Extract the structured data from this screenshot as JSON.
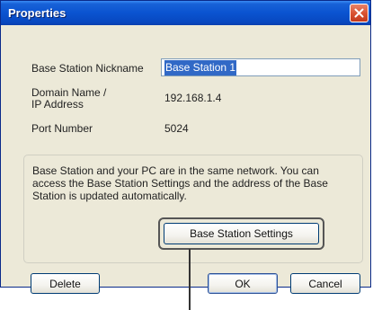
{
  "window": {
    "title": "Properties"
  },
  "fields": {
    "nickname_label": "Base Station Nickname",
    "nickname_value": "Base Station 1",
    "domain_label_line1": "Domain Name /",
    "domain_label_line2": "IP Address",
    "domain_value": "192.168.1.4",
    "port_label": "Port Number",
    "port_value": "5024"
  },
  "info": {
    "line1": "Base Station and your PC are in the same network. You can",
    "line2": "access the Base Station Settings and the address of the Base",
    "line3": "Station is updated automatically."
  },
  "buttons": {
    "settings": "Base Station Settings",
    "delete": "Delete",
    "ok": "OK",
    "cancel": "Cancel"
  },
  "icons": {
    "close": "close-icon"
  },
  "colors": {
    "titlebar": "#0a53d0",
    "dialog_bg": "#ece9d8",
    "close_button": "#d8502f",
    "selection": "#3169c6"
  }
}
